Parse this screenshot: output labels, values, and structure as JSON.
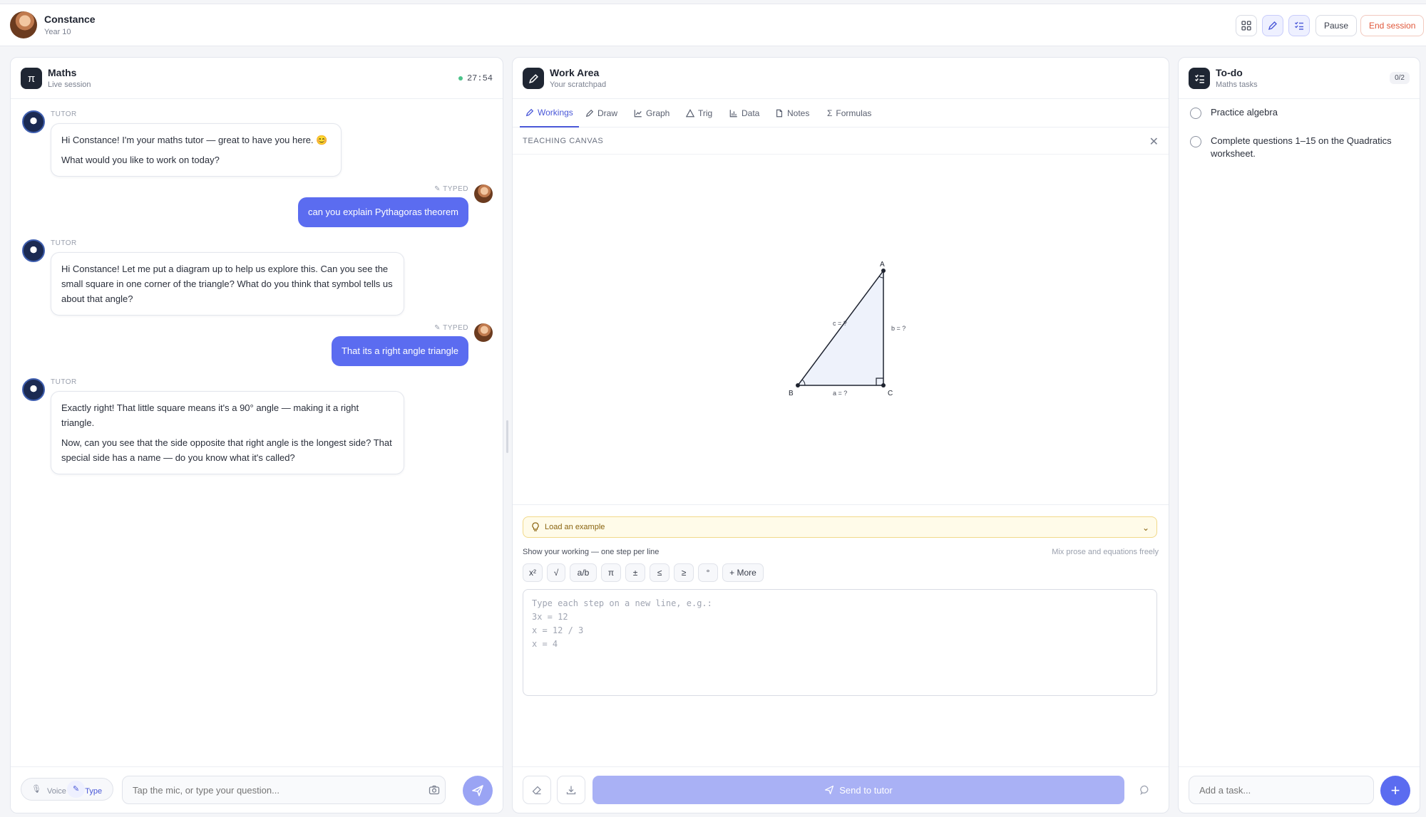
{
  "user": {
    "name": "Constance",
    "year": "Year 10"
  },
  "header": {
    "pause_label": "Pause",
    "end_label": "End session"
  },
  "chat": {
    "title": "Maths",
    "subtitle": "Live session",
    "timer": "27:54",
    "icon_glyph": "π",
    "tutor_label": "TUTOR",
    "typed_label": "TYPED",
    "messages": [
      {
        "role": "tutor",
        "paragraphs": [
          "Hi Constance! I'm your maths tutor — great to have you here. 😊",
          "What would you like to work on today?"
        ]
      },
      {
        "role": "user",
        "text": "can you explain Pythagoras theorem"
      },
      {
        "role": "tutor",
        "paragraphs": [
          "Hi Constance! Let me put a diagram up to help us explore this. Can you see the small square in one corner of the triangle? What do you think that symbol tells us about that angle?"
        ]
      },
      {
        "role": "user",
        "text": "That its a right angle triangle"
      },
      {
        "role": "tutor",
        "paragraphs": [
          "Exactly right! That little square means it's a 90° angle — making it a right triangle.",
          "Now, can you see that the side opposite that right angle is the longest side? That special side has a name — do you know what it's called?"
        ]
      }
    ],
    "voice_label": "Voice",
    "type_label": "Type",
    "input_placeholder": "Tap the mic, or type your question..."
  },
  "work": {
    "title": "Work Area",
    "subtitle": "Your scratchpad",
    "tabs": [
      "Workings",
      "Draw",
      "Graph",
      "Trig",
      "Data",
      "Notes",
      "Formulas"
    ],
    "active_tab": "Workings",
    "canvas_title": "TEACHING CANVAS",
    "diagram": {
      "vertex_a": "A",
      "vertex_b": "B",
      "vertex_c": "C",
      "side_a": "a = ?",
      "side_b": "b = ?",
      "side_c": "c = ?"
    },
    "example_label": "Load an example",
    "show_working": "Show your working — one step per line",
    "mix_hint": "Mix prose and equations freely",
    "symbols": [
      "x²",
      "√",
      "a/b",
      "π",
      "±",
      "≤",
      "≥",
      "°",
      "+ More"
    ],
    "work_placeholder": "Type each step on a new line, e.g.:\n3x = 12\nx = 12 / 3\nx = 4",
    "send_label": "Send to tutor"
  },
  "todo": {
    "title": "To-do",
    "subtitle": "Maths tasks",
    "count": "0/2",
    "items": [
      "Practice algebra",
      "Complete questions 1–15 on the Quadratics worksheet."
    ],
    "add_placeholder": "Add a task..."
  },
  "colors": {
    "accent": "#5b6cf0",
    "danger": "#e0573a",
    "dark": "#1f2633",
    "warning_bg": "#fffbe9"
  }
}
